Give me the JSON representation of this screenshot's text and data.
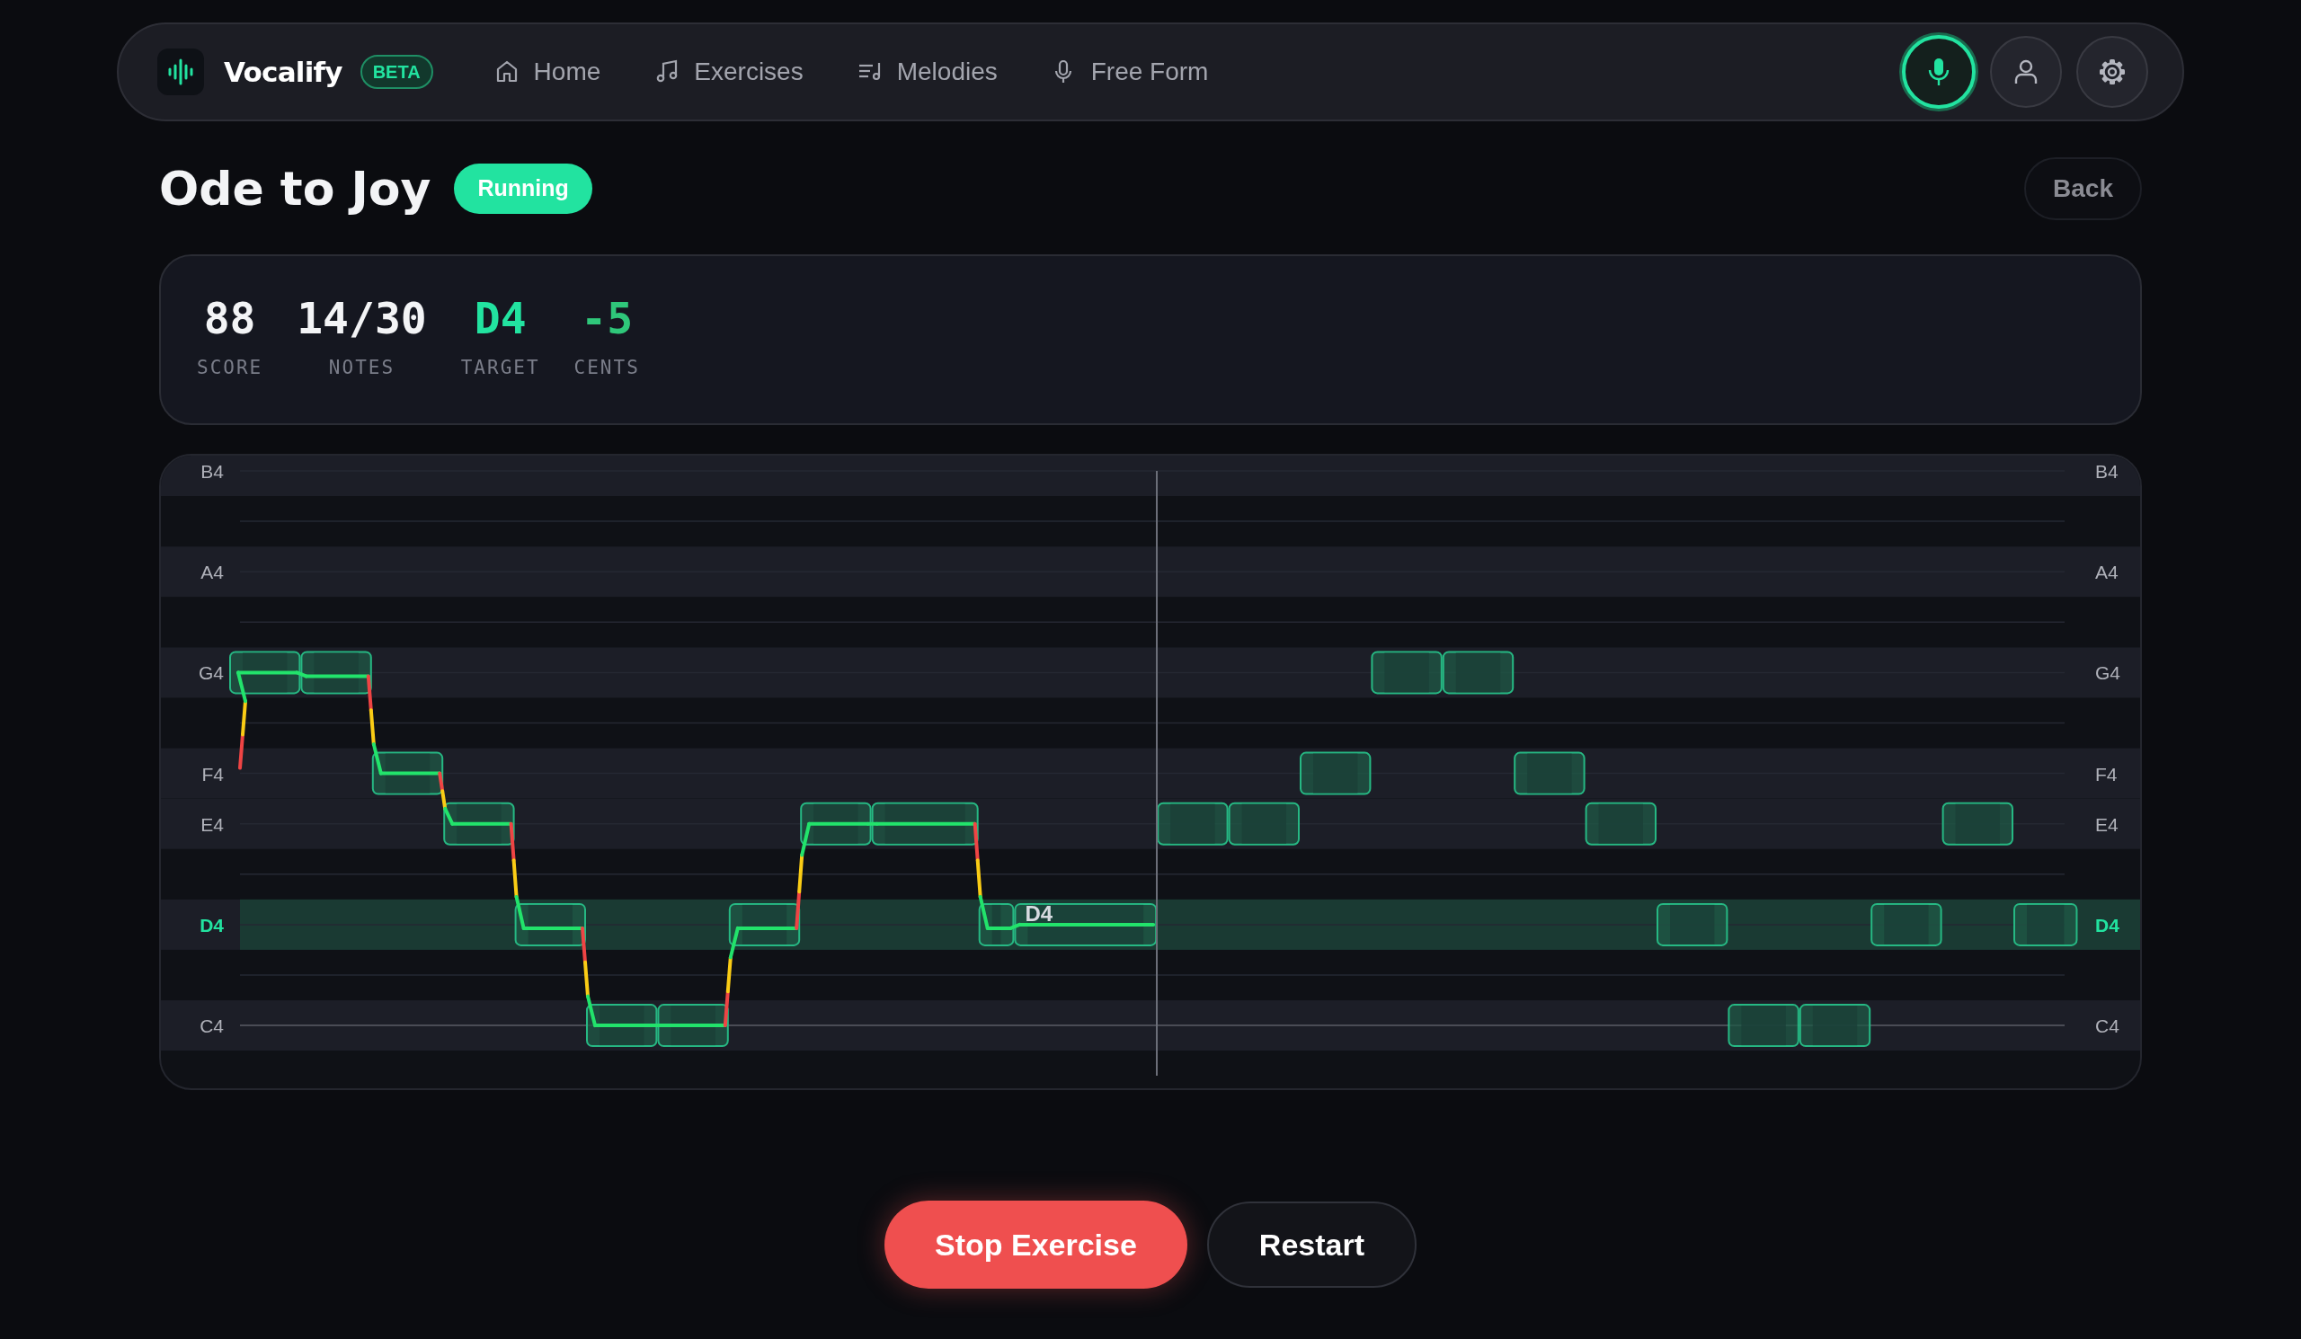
{
  "app": {
    "name": "Vocalify",
    "badge": "BETA"
  },
  "nav": [
    {
      "label": "Home",
      "kind": "home"
    },
    {
      "label": "Exercises",
      "kind": "note"
    },
    {
      "label": "Melodies",
      "kind": "playlist"
    },
    {
      "label": "Free Form",
      "kind": "mic"
    }
  ],
  "header_buttons": [
    {
      "kind": "mic",
      "on": true
    },
    {
      "kind": "user",
      "on": false
    },
    {
      "kind": "settings",
      "on": false
    }
  ],
  "exercise": {
    "title": "Ode to Joy",
    "status": "Running",
    "back": "Back"
  },
  "stats": [
    {
      "value": "88",
      "label": "SCORE",
      "color": "#f3f4f6"
    },
    {
      "value": "14/30",
      "label": "NOTES",
      "color": "#f3f4f6"
    },
    {
      "value": "D4",
      "label": "TARGET",
      "color": "#22e3a0"
    },
    {
      "value": "-5",
      "label": "CENTS",
      "color": "#2fc77a"
    }
  ],
  "pitch_rows": [
    {
      "left_label": "B4",
      "right_label": "B4",
      "target": false
    },
    {
      "left_label": "A4",
      "right_label": "A4",
      "target": false
    },
    {
      "left_label": "G4",
      "right_label": "G4",
      "target": false
    },
    {
      "left_label": "F4",
      "right_label": "F4",
      "target": false
    },
    {
      "left_label": "E4",
      "right_label": "E4",
      "target": false
    },
    {
      "left_label": "D4",
      "right_label": "D4",
      "target": true
    },
    {
      "left_label": "C4",
      "right_label": "C4",
      "target": false
    }
  ],
  "current_note_label": "D4",
  "actions": [
    {
      "label": "Stop Exercise",
      "kind": "primary"
    },
    {
      "label": "Restart",
      "kind": "secondary"
    }
  ]
}
